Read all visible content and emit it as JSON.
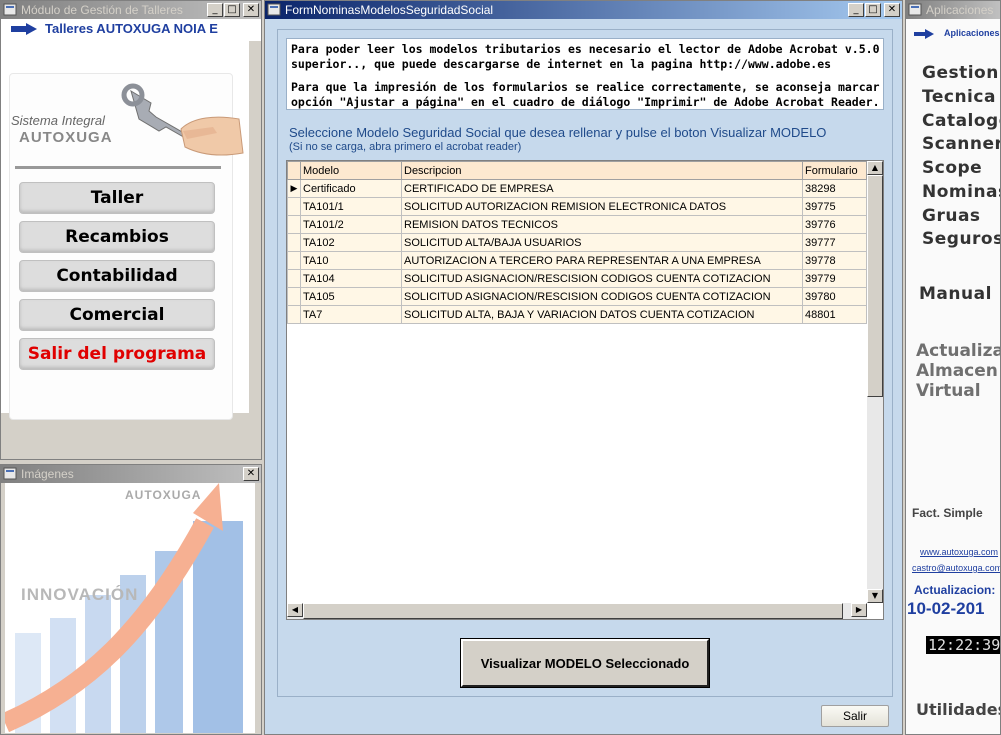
{
  "left_window": {
    "title": "Módulo de Gestión de Talleres",
    "banner": "Talleres AUTOXUGA NOIA E",
    "logo_line1": "Sistema Integral",
    "logo_line2": "AUTOXUGA",
    "buttons": [
      "Taller",
      "Recambios",
      "Contabilidad",
      "Comercial",
      "Salir del programa"
    ]
  },
  "images_window": {
    "title": "Imágenes",
    "brand": "AUTOXUGA",
    "slogan": "INNOVACIÓN"
  },
  "main_window": {
    "title": "FormNominasModelosSeguridadSocial",
    "info_line1": "Para poder leer los modelos tributarios es necesario el lector de Adobe Acrobat v.5.0 ó",
    "info_line2": "superior.., que puede descargarse de internet en la pagina http://www.adobe.es",
    "info_line3": "Para que la impresión de los formularios se realice correctamente, se aconseja marcar la",
    "info_line4": "opción \"Ajustar a página\" en el cuadro de diálogo \"Imprimir\" de Adobe Acrobat Reader.",
    "prompt": "Seleccione Modelo Seguridad Social que desea rellenar y pulse el boton Visualizar MODELO",
    "prompt_sub": "(Si no se carga, abra primero el acrobat reader)",
    "columns": [
      "Modelo",
      "Descripcion",
      "Formulario"
    ],
    "rows": [
      [
        "Certificado",
        "CERTIFICADO DE EMPRESA",
        "38298"
      ],
      [
        "TA101/1",
        "SOLICITUD AUTORIZACION REMISION ELECTRONICA DATOS",
        "39775"
      ],
      [
        "TA101/2",
        "REMISION DATOS TECNICOS",
        "39776"
      ],
      [
        "TA102",
        "SOLICITUD ALTA/BAJA USUARIOS",
        "39777"
      ],
      [
        "TA10",
        "AUTORIZACION A TERCERO PARA REPRESENTAR A UNA EMPRESA",
        "39778"
      ],
      [
        "TA104",
        "SOLICITUD ASIGNACION/RESCISION CODIGOS CUENTA COTIZACION",
        "39779"
      ],
      [
        "TA105",
        "SOLICITUD ASIGNACION/RESCISION CODIGOS CUENTA COTIZACION",
        "39780"
      ],
      [
        "TA7",
        "SOLICITUD ALTA, BAJA Y VARIACION DATOS CUENTA COTIZACION",
        "48801"
      ]
    ],
    "view_button": "Visualizar MODELO Seleccionado",
    "exit_button": "Salir"
  },
  "right_window": {
    "title": "Aplicaciones",
    "banner": "Aplicaciones",
    "links": [
      "Gestion",
      "Tecnica",
      "Catalogo",
      "Scanner",
      "Scope",
      "Nominas",
      "Gruas",
      "Seguros"
    ],
    "manual": "Manual",
    "grey_line1": "Actualizar",
    "grey_line2": "Almacen",
    "grey_line3": "Virtual",
    "fact": "Fact. Simple",
    "web": "www.autoxuga.com",
    "email": "castro@autoxuga.com",
    "updates_label": "Actualizacion:",
    "update_date": "10-02-201",
    "clock": "12:22:39",
    "utilities": "Utilidades"
  },
  "colors": {
    "titlebar_active": "#0a246a",
    "titlebar_inactive": "#808080",
    "grid_row": "#fff7e6",
    "accent_blue": "#1f3fa0",
    "exit_red": "#e00000"
  }
}
